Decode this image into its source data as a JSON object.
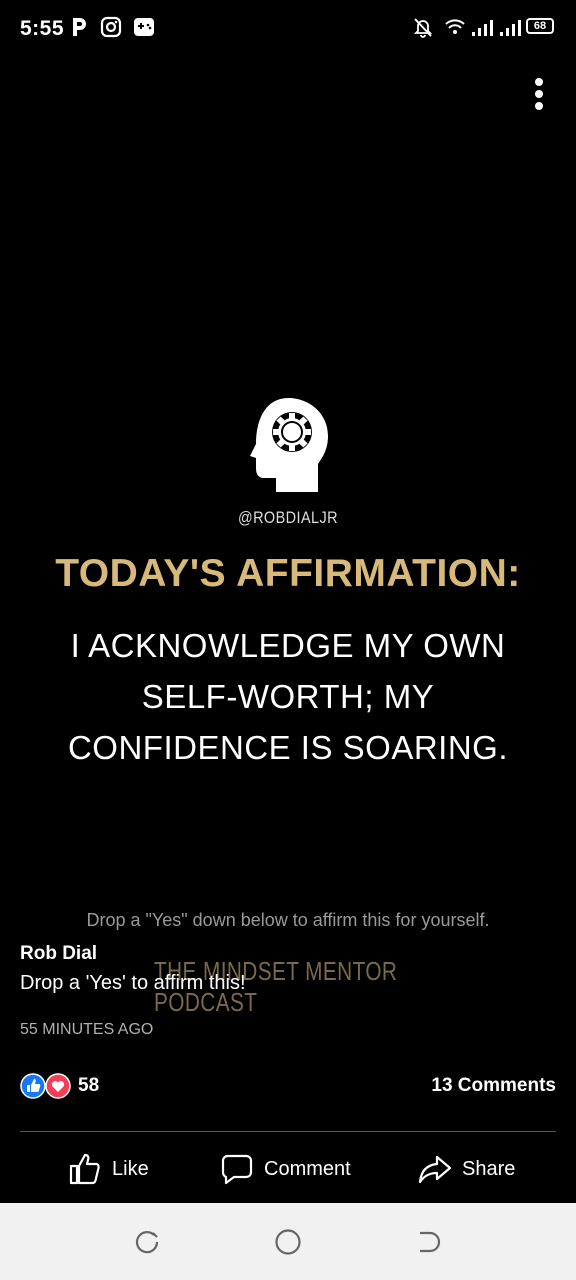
{
  "status_bar": {
    "time": "5:55",
    "battery": "68",
    "icons": [
      "parking-icon",
      "instagram-icon",
      "gamepad-icon",
      "bell-off-icon",
      "wifi-icon",
      "signal-icon",
      "signal-icon",
      "battery-icon"
    ]
  },
  "post_image": {
    "handle": "@ROBDIALJR",
    "title": "TODAY'S AFFIRMATION:",
    "body_lines": [
      "I ACKNOWLEDGE MY OWN",
      "SELF-WORTH; MY",
      "CONFIDENCE IS SOARING."
    ],
    "cta": "Drop a \"Yes\" down below to affirm this for yourself.",
    "podcast_name": "THE MINDSET MENTOR PODCAST",
    "title_color": "#d8b97a"
  },
  "post": {
    "author": "Rob Dial",
    "caption": "Drop a 'Yes' to affirm this!",
    "time_ago": "55 MINUTES AGO",
    "reaction_count": "58",
    "comments_count": "13 Comments"
  },
  "actions": {
    "like": "Like",
    "comment": "Comment",
    "share": "Share"
  },
  "colors": {
    "like_blue": "#1877f2",
    "love_red": "#f33e58",
    "background": "#000000"
  }
}
